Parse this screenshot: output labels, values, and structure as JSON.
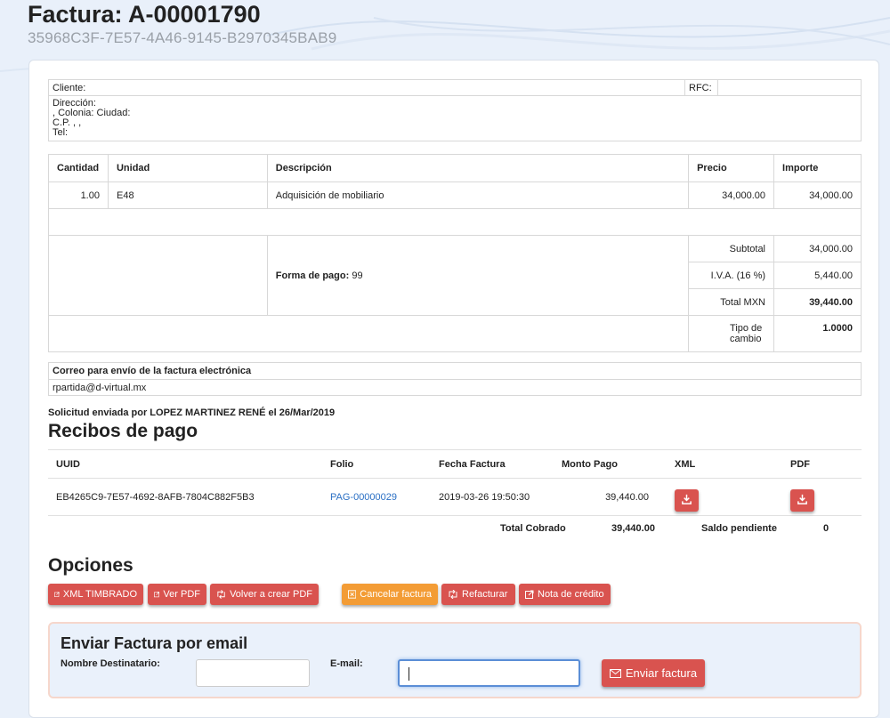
{
  "header": {
    "title": "Factura: A-00001790",
    "uuid": "35968C3F-7E57-4A46-9145-B2970345BAB9"
  },
  "client": {
    "cliente_label": "Cliente:",
    "rfc_label": "RFC:",
    "address_lines": [
      "Dirección:",
      ", Colonia: Ciudad:",
      "C.P. , ,",
      "Tel:"
    ]
  },
  "items": {
    "headers": {
      "cantidad": "Cantidad",
      "unidad": "Unidad",
      "descripcion": "Descripción",
      "precio": "Precio",
      "importe": "Importe"
    },
    "rows": [
      {
        "cantidad": "1.00",
        "unidad": "E48",
        "descripcion": "Adquisición de mobiliario",
        "precio": "34,000.00",
        "importe": "34,000.00"
      }
    ],
    "forma_pago_label": "Forma de pago:",
    "forma_pago_value": "99",
    "subtotal_label": "Subtotal",
    "subtotal_value": "34,000.00",
    "iva_label": "I.V.A. (16 %)",
    "iva_value": "5,440.00",
    "total_label": "Total MXN",
    "total_value": "39,440.00",
    "tipo_cambio_label": "Tipo de cambio",
    "tipo_cambio_value": "1.0000"
  },
  "email_box": {
    "title": "Correo para envío de la factura electrónica",
    "value": "rpartida@d-virtual.mx"
  },
  "solicitud": "Solicitud enviada por LOPEZ MARTINEZ RENÉ el 26/Mar/2019",
  "recibos": {
    "title": "Recibos de pago",
    "headers": {
      "uuid": "UUID",
      "folio": "Folio",
      "fecha": "Fecha Factura",
      "monto": "Monto Pago",
      "xml": "XML",
      "pdf": "PDF"
    },
    "rows": [
      {
        "uuid": "EB4265C9-7E57-4692-8AFB-7804C882F5B3",
        "folio": "PAG-00000029",
        "fecha": "2019-03-26 19:50:30",
        "monto": "39,440.00"
      }
    ],
    "total_cobrado_label": "Total Cobrado",
    "total_cobrado_value": "39,440.00",
    "saldo_label": "Saldo pendiente",
    "saldo_value": "0"
  },
  "opciones": {
    "title": "Opciones",
    "buttons": {
      "xml_timbrado": "XML TIMBRADO",
      "ver_pdf": "Ver PDF",
      "volver_crear_pdf": "Volver a crear PDF",
      "cancelar": "Cancelar factura",
      "refacturar": "Refacturar",
      "nota_credito": "Nota de crédito"
    }
  },
  "send_email": {
    "title": "Enviar Factura por email",
    "nombre_label": "Nombre Destinatario:",
    "email_label": "E-mail:",
    "nombre_value": "",
    "email_value": "",
    "button": "Enviar factura"
  },
  "colors": {
    "danger": "#d9534f",
    "warning": "#f39c35",
    "link": "#2a6fc4",
    "background": "#e9f0fa"
  }
}
